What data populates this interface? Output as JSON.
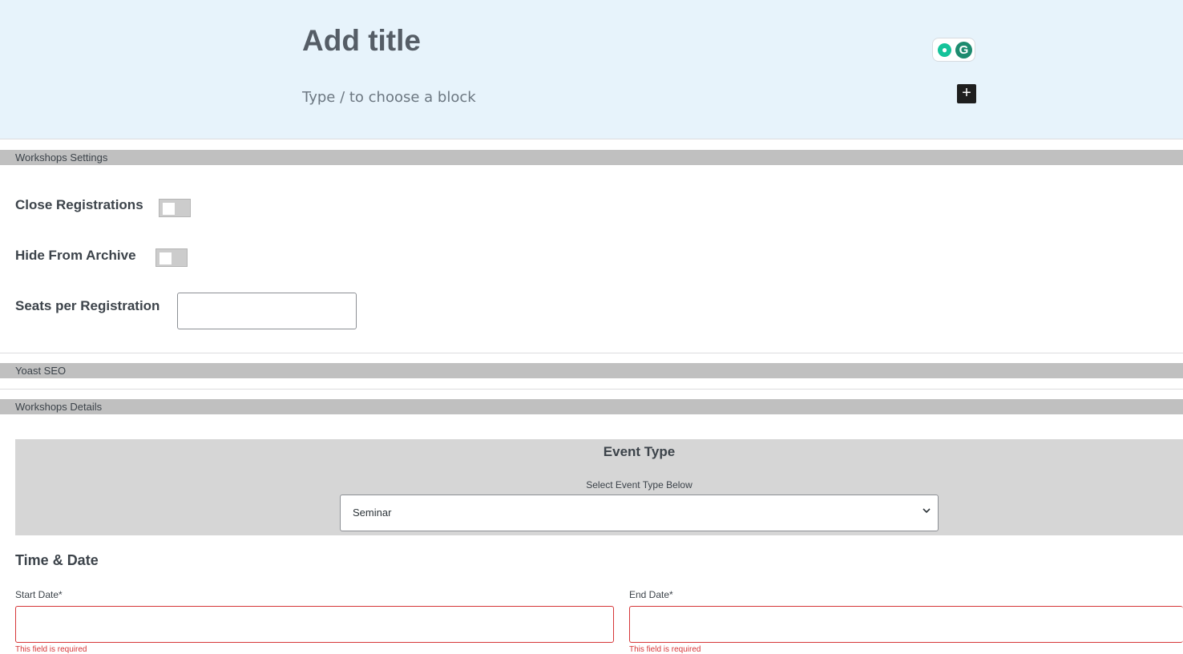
{
  "editor": {
    "title_placeholder": "Add title",
    "block_placeholder": "Type / to choose a block",
    "add_block_symbol": "+"
  },
  "panels": {
    "workshops_settings": "Workshops Settings",
    "yoast_seo": "Yoast SEO",
    "workshops_details": "Workshops Details"
  },
  "settings": {
    "close_registrations_label": "Close Registrations",
    "close_registrations_on": false,
    "hide_from_archive_label": "Hide From Archive",
    "hide_from_archive_on": false,
    "seats_label": "Seats per Registration",
    "seats_value": ""
  },
  "event_type": {
    "title": "Event Type",
    "subtitle": "Select Event Type Below",
    "selected": "Seminar"
  },
  "time_date": {
    "title": "Time & Date",
    "start_label": "Start Date*",
    "end_label": "End Date*",
    "start_value": "",
    "end_value": "",
    "error_text": "This field is required"
  },
  "colors": {
    "editor_bg": "#e7f3fb",
    "panel_header_bg": "#c0c0c0",
    "error": "#d63638"
  },
  "icons": {
    "grammarly_bulb": "lightbulb-icon",
    "grammarly_logo": "grammarly-g-icon",
    "add_block": "plus-icon",
    "select_chevron": "chevron-down-icon"
  }
}
